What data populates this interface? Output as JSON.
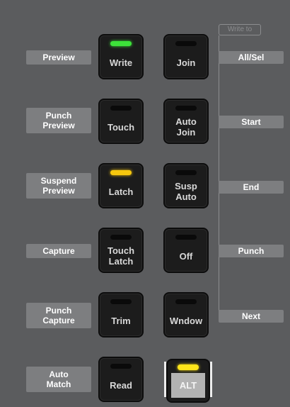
{
  "header": {
    "write_to": "Write to"
  },
  "left_labels": [
    "Preview",
    "Punch\nPreview",
    "Suspend\nPreview",
    "Capture",
    "Punch\nCapture",
    "Auto\nMatch"
  ],
  "left_buttons": [
    {
      "label": "Write",
      "led": "green"
    },
    {
      "label": "Touch",
      "led": "off"
    },
    {
      "label": "Latch",
      "led": "yellow"
    },
    {
      "label": "Touch\nLatch",
      "led": "off"
    },
    {
      "label": "Trim",
      "led": "off"
    },
    {
      "label": "Read",
      "led": "off"
    }
  ],
  "right_buttons": [
    {
      "label": "Join",
      "led": "off"
    },
    {
      "label": "Auto\nJoin",
      "led": "off"
    },
    {
      "label": "Susp\nAuto",
      "led": "off"
    },
    {
      "label": "Off",
      "led": "off"
    },
    {
      "label": "Wndow",
      "led": "off"
    }
  ],
  "alt_button": {
    "label": "ALT",
    "led": "yellow"
  },
  "right_labels": [
    "All/Sel",
    "Start",
    "End",
    "Punch",
    "Next"
  ],
  "colors": {
    "background": "#5b5c5e",
    "label_bg": "#7d7e80",
    "button_bg": "#1c1c1c",
    "led_green": "#3de23a",
    "led_yellow": "#f6c70e"
  }
}
